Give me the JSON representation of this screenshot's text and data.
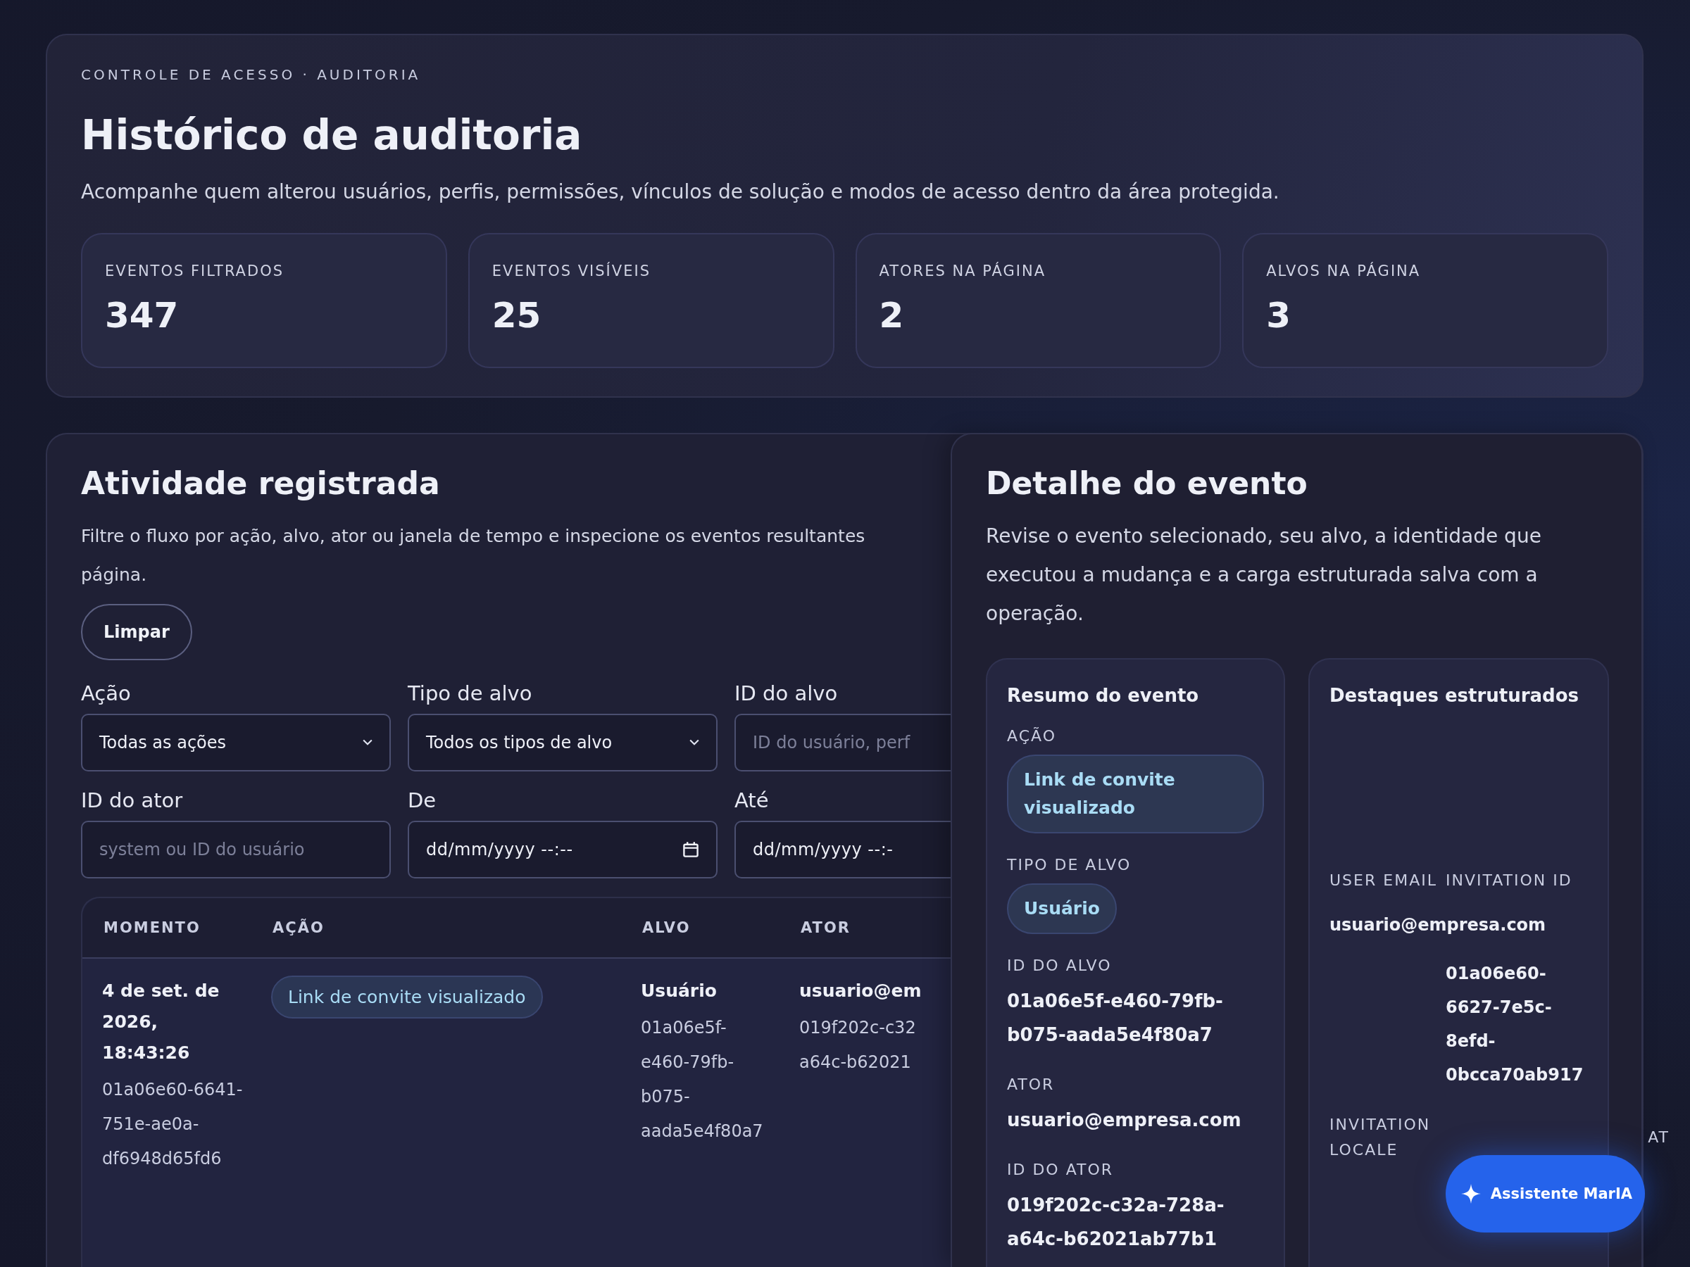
{
  "header": {
    "eyebrow": "CONTROLE DE ACESSO · AUDITORIA",
    "title": "Histórico de auditoria",
    "description": "Acompanhe quem alterou usuários, perfis, permissões, vínculos de solução e modos de acesso dentro da área protegida.",
    "stats": [
      {
        "label": "EVENTOS FILTRADOS",
        "value": "347"
      },
      {
        "label": "EVENTOS VISÍVEIS",
        "value": "25"
      },
      {
        "label": "ATORES NA PÁGINA",
        "value": "2"
      },
      {
        "label": "ALVOS NA PÁGINA",
        "value": "3"
      }
    ]
  },
  "activity": {
    "title": "Atividade registrada",
    "description_lines": [
      "Filtre o fluxo por ação, alvo, ator ou janela de tempo e inspecione os eventos resultantes",
      "página."
    ],
    "clear_button": "Limpar",
    "filters": [
      {
        "kind": "select",
        "label": "Ação",
        "value": "Todas as ações"
      },
      {
        "kind": "select",
        "label": "Tipo de alvo",
        "value": "Todos os tipos de alvo"
      },
      {
        "kind": "text",
        "label": "ID do alvo",
        "placeholder": "ID do usuário, perf"
      },
      {
        "kind": "text",
        "label": "ID do ator",
        "placeholder": "system ou ID do usuário"
      },
      {
        "kind": "date",
        "label": "De",
        "value": "dd/mm/yyyy --:--",
        "icon": true
      },
      {
        "kind": "date",
        "label": "Até",
        "value": "dd/mm/yyyy --:-",
        "icon": false
      }
    ],
    "table": {
      "columns": [
        "MOMENTO",
        "AÇÃO",
        "ALVO",
        "ATOR"
      ],
      "rows": [
        {
          "moment": "4 de set. de 2026, 18:43:26",
          "event_id": "01a06e60-6641-751e-ae0a-df6948d65fd6",
          "action": "Link de convite visualizado",
          "target_type": "Usuário",
          "target_id": "01a06e5f-e460-79fb-b075-aada5e4f80a7",
          "actor": "usuario@em",
          "actor_id_lines": [
            "019f202c-c32",
            "a64c-b62021"
          ]
        }
      ]
    }
  },
  "detail": {
    "title": "Detalhe do evento",
    "description": "Revise o evento selecionado, seu alvo, a identidade que executou a mudança e a carga estruturada salva com a operação.",
    "summary": {
      "title": "Resumo do evento",
      "fields": [
        {
          "kind": "pill",
          "label": "AÇÃO",
          "value": "Link de convite visualizado"
        },
        {
          "kind": "pill",
          "label": "TIPO DE ALVO",
          "value": "Usuário"
        },
        {
          "kind": "text",
          "label": "ID DO ALVO",
          "value": "01a06e5f-e460-79fb-b075-aada5e4f80a7"
        },
        {
          "kind": "text",
          "label": "ATOR",
          "value": "usuario@empresa.com"
        },
        {
          "kind": "text",
          "label": "ID DO ATOR",
          "value": "019f202c-c32a-728a-a64c-b62021ab77b1"
        }
      ]
    },
    "highlights": {
      "title": "Destaques estruturados",
      "items": [
        {
          "label": "USER EMAIL",
          "value": "usuario@empresa.com"
        },
        {
          "label": "INVITATION ID",
          "value": "01a06e60-6627-7e5c-8efd-0bcca70ab917"
        },
        {
          "label": "INVITATION LOCALE"
        },
        {
          "label": "AT"
        }
      ]
    }
  },
  "assistant_button": "Assistente MarIA"
}
